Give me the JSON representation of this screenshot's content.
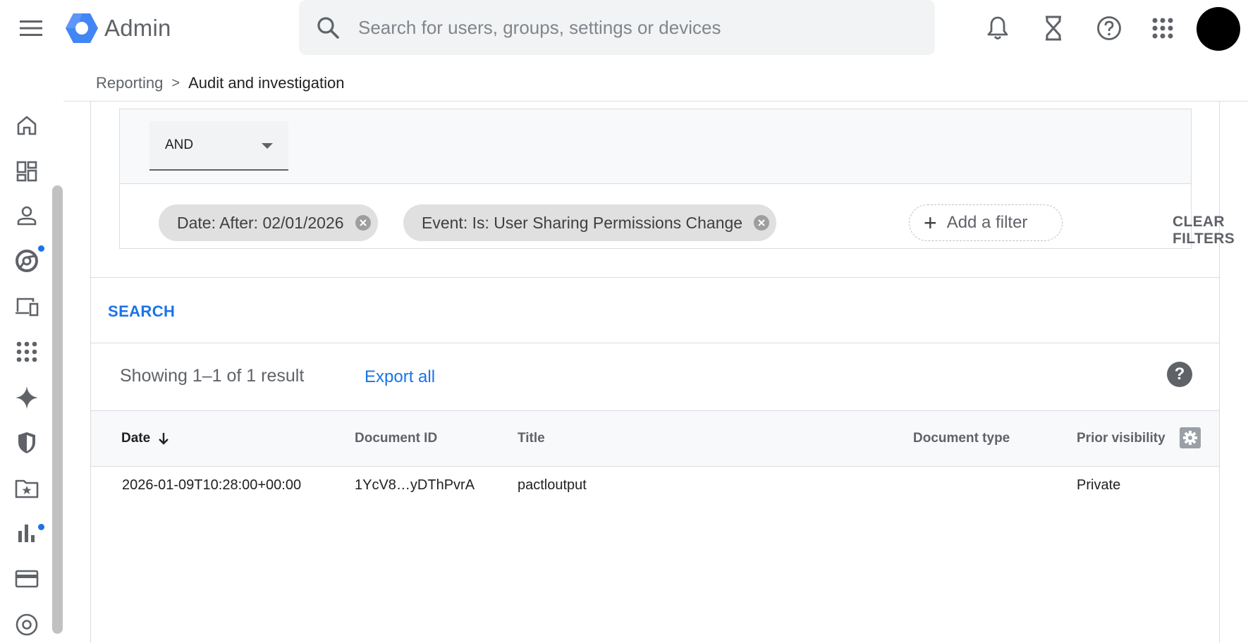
{
  "app": {
    "title": "Admin"
  },
  "search": {
    "placeholder": "Search for users, groups, settings or devices"
  },
  "breadcrumb": {
    "parent": "Reporting",
    "separator": ">",
    "current": "Audit and investigation"
  },
  "filters": {
    "operator": "AND",
    "chips": [
      {
        "label": "Date: After: 02/01/2026"
      },
      {
        "label": "Event: Is: User Sharing Permissions Change"
      }
    ],
    "add_filter_label": "Add a filter",
    "clear_label": "CLEAR FILTERS"
  },
  "search_action": {
    "label": "SEARCH"
  },
  "results": {
    "summary": "Showing 1–1 of 1 result",
    "export_label": "Export all",
    "columns": [
      "Date",
      "Document ID",
      "Title",
      "Document type",
      "Prior visibility"
    ],
    "rows": [
      {
        "date": "2026-01-09T10:28:00+00:00",
        "document_id": "1YcV8…yDThPvrA",
        "title": "pactloutput",
        "document_type": "",
        "prior_visibility": "Private"
      }
    ]
  },
  "colors": {
    "accent": "#1a73e8",
    "rail_dot": "#1a73e8",
    "chip_bg": "#e0e0e0"
  },
  "icons": {
    "topbar": [
      "menu-icon",
      "search-icon",
      "notifications-icon",
      "hourglass-icon",
      "help-icon",
      "apps-icon"
    ],
    "rail": [
      "home-icon",
      "dashboard-icon",
      "person-icon",
      "chrome-icon",
      "devices-icon",
      "apps-grid-icon",
      "sparkle-icon",
      "shield-icon",
      "folder-star-icon",
      "bar-chart-icon",
      "billing-icon",
      "account-icon"
    ]
  }
}
